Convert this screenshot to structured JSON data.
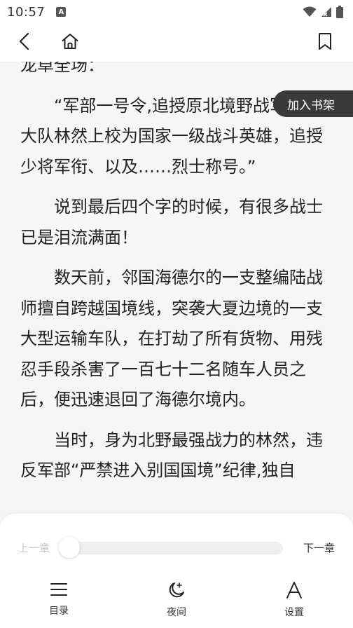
{
  "status_bar": {
    "time": "10:57",
    "notification_badge": "A",
    "icons": [
      "wifi-icon",
      "signal-icon",
      "battery-icon"
    ]
  },
  "toolbar": {
    "icons": [
      "back-arrow-icon",
      "home-icon",
      "bookmark-icon"
    ]
  },
  "content": {
    "paragraphs": [
      "龙卓全场：",
      "“军部一号令,追授原北境野战军特种大队林然上校为国家一级战斗英雄，追授少将军衔、以及……烈士称号。”",
      "说到最后四个字的时候，有很多战士已是泪流满面！",
      "数天前，邻国海德尔的一支整编陆战师擅自跨越国境线，突袭大夏边境的一支大型运输车队，在打劫了所有货物、用残忍手段杀害了一百七十二名随车人员之后，便迅速退回了海德尔境内。",
      "当时，身为北野最强战力的林然，违反军部“严禁进入别国国境”纪律,独自"
    ]
  },
  "add_shelf": {
    "label": "加入书架"
  },
  "bottom_panel": {
    "prev_chapter": "上一章",
    "next_chapter": "下一章",
    "progress": 0,
    "nav": [
      {
        "label": "目录",
        "icon": "menu-list-icon"
      },
      {
        "label": "夜间",
        "icon": "moon-icon"
      },
      {
        "label": "设置",
        "icon": "font-a-icon"
      }
    ]
  },
  "colors": {
    "page_background": "#f6f6f6",
    "text": "#222222",
    "pill_background": "#3a3a3a",
    "disabled_text": "#c8c8c8"
  }
}
